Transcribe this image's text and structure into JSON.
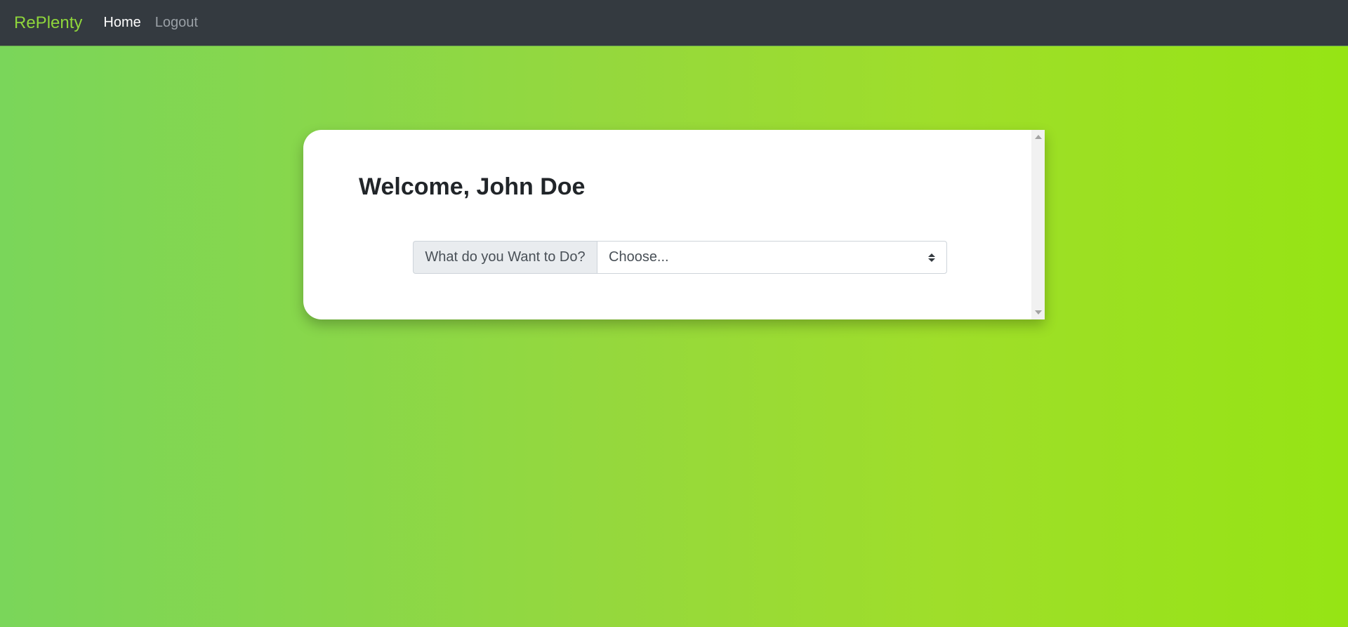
{
  "navbar": {
    "brand": "RePlenty",
    "links": [
      {
        "label": "Home",
        "active": true
      },
      {
        "label": "Logout",
        "active": false
      }
    ]
  },
  "card": {
    "title": "Welcome, John Doe",
    "action_label": "What do you Want to Do?",
    "select": {
      "selected": "Choose...",
      "icon": "select-arrows-icon"
    }
  },
  "colors": {
    "navbar_bg": "#343a40",
    "brand": "#8fd63b",
    "gradient_start": "#7ad65a",
    "gradient_end": "#96e414"
  }
}
